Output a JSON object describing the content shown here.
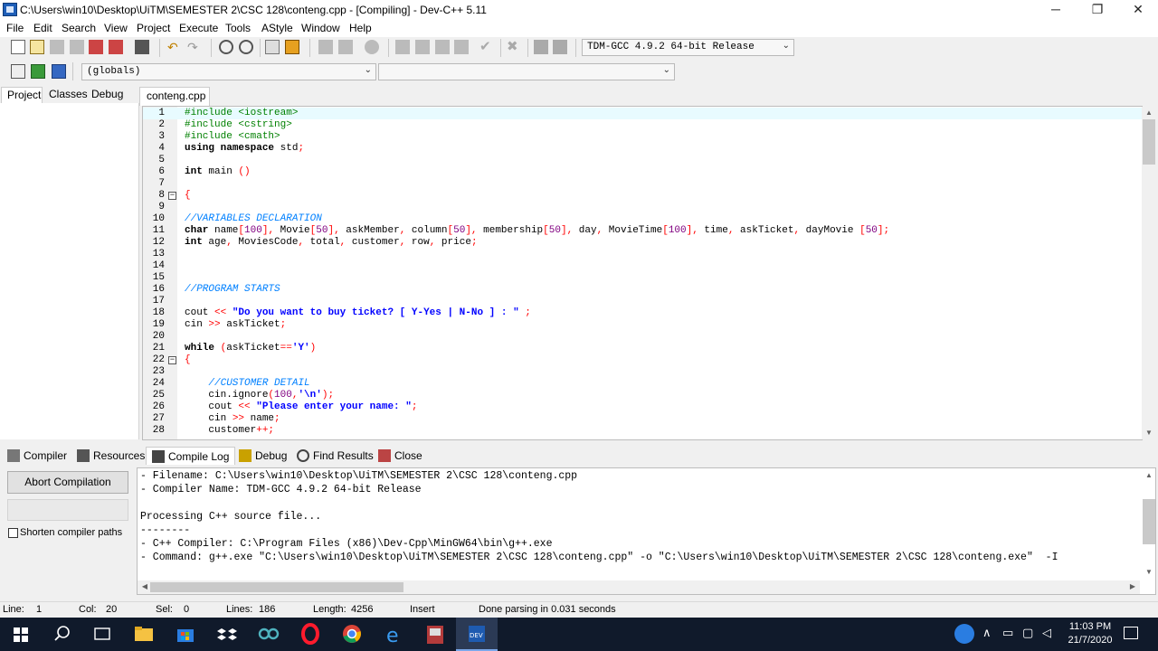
{
  "window": {
    "title": "C:\\Users\\win10\\Desktop\\UiTM\\SEMESTER 2\\CSC 128\\conteng.cpp - [Compiling] - Dev-C++ 5.11",
    "minimize": "─",
    "restore": "❐",
    "close": "✕"
  },
  "menu": [
    "File",
    "Edit",
    "Search",
    "View",
    "Project",
    "Execute",
    "Tools",
    "AStyle",
    "Window",
    "Help"
  ],
  "toolbar": {
    "compiler_select": "TDM-GCC 4.9.2 64-bit Release",
    "scope_select": "(globals)",
    "member_select": ""
  },
  "left_tabs": [
    "Project",
    "Classes",
    "Debug"
  ],
  "file_tab": "conteng.cpp",
  "code": [
    {
      "n": "1",
      "t": "#include <iostream>"
    },
    {
      "n": "2",
      "t": "#include <cstring>"
    },
    {
      "n": "3",
      "t": "#include <cmath>"
    },
    {
      "n": "4",
      "t": "using namespace std;"
    },
    {
      "n": "5",
      "t": ""
    },
    {
      "n": "6",
      "t": "int main ()"
    },
    {
      "n": "7",
      "t": ""
    },
    {
      "n": "8",
      "t": "{"
    },
    {
      "n": "9",
      "t": ""
    },
    {
      "n": "10",
      "t": "//VARIABLES DECLARATION"
    },
    {
      "n": "11",
      "t": "char name[100], Movie[50], askMember, column[50], membership[50], day, MovieTime[100], time, askTicket, dayMovie [50];"
    },
    {
      "n": "12",
      "t": "int age, MoviesCode, total, customer, row, price;"
    },
    {
      "n": "13",
      "t": ""
    },
    {
      "n": "14",
      "t": ""
    },
    {
      "n": "15",
      "t": ""
    },
    {
      "n": "16",
      "t": "//PROGRAM STARTS"
    },
    {
      "n": "17",
      "t": ""
    },
    {
      "n": "18",
      "t": "cout << \"Do you want to buy ticket? [ Y-Yes | N-No ] : \" ;"
    },
    {
      "n": "19",
      "t": "cin >> askTicket;"
    },
    {
      "n": "20",
      "t": ""
    },
    {
      "n": "21",
      "t": "while (askTicket=='Y')"
    },
    {
      "n": "22",
      "t": "{"
    },
    {
      "n": "23",
      "t": ""
    },
    {
      "n": "24",
      "t": "    //CUSTOMER DETAIL"
    },
    {
      "n": "25",
      "t": "    cin.ignore(100,'\\n');"
    },
    {
      "n": "26",
      "t": "    cout << \"Please enter your name: \";"
    },
    {
      "n": "27",
      "t": "    cin >> name;"
    },
    {
      "n": "28",
      "t": "    customer++;"
    }
  ],
  "bottom_tabs": [
    "Compiler",
    "Resources",
    "Compile Log",
    "Debug",
    "Find Results",
    "Close"
  ],
  "compile": {
    "abort_label": "Abort Compilation",
    "shorten_label": "Shorten compiler paths",
    "log": [
      "- Filename: C:\\Users\\win10\\Desktop\\UiTM\\SEMESTER 2\\CSC 128\\conteng.cpp",
      "- Compiler Name: TDM-GCC 4.9.2 64-bit Release",
      "",
      "Processing C++ source file...",
      "--------",
      "- C++ Compiler: C:\\Program Files (x86)\\Dev-Cpp\\MinGW64\\bin\\g++.exe",
      "- Command: g++.exe \"C:\\Users\\win10\\Desktop\\UiTM\\SEMESTER 2\\CSC 128\\conteng.cpp\" -o \"C:\\Users\\win10\\Desktop\\UiTM\\SEMESTER 2\\CSC 128\\conteng.exe\"  -I"
    ]
  },
  "status": {
    "line_label": "Line:",
    "line": "1",
    "col_label": "Col:",
    "col": "20",
    "sel_label": "Sel:",
    "sel": "0",
    "lines_label": "Lines:",
    "lines": "186",
    "length_label": "Length:",
    "length": "4256",
    "mode": "Insert",
    "message": "Done parsing in 0.031 seconds"
  },
  "clock": {
    "time": "11:03 PM",
    "date": "21/7/2020"
  }
}
